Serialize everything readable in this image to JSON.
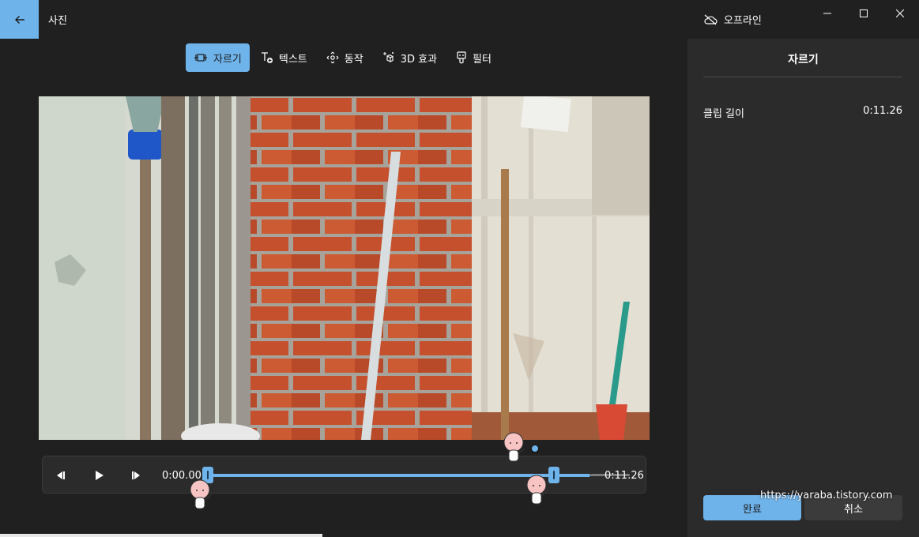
{
  "window": {
    "title": "사진",
    "offline_label": "오프라인",
    "controls": [
      "minimize-icon",
      "maximize-icon",
      "close-icon"
    ]
  },
  "toolbar": {
    "items": [
      {
        "label": "자르기",
        "icon": "trim-icon",
        "active": true
      },
      {
        "label": "텍스트",
        "icon": "text-add-icon",
        "active": false
      },
      {
        "label": "동작",
        "icon": "motion-icon",
        "active": false
      },
      {
        "label": "3D 효과",
        "icon": "3d-effects-icon",
        "active": false
      },
      {
        "label": "필터",
        "icon": "filter-icon",
        "active": false
      }
    ]
  },
  "player": {
    "start_time": "0:00.00",
    "end_time": "0:11.26",
    "trim_end_fraction": 1.0,
    "playhead_fraction": 0.9
  },
  "panel": {
    "title": "자르기",
    "clip_length_label": "클립 길이",
    "clip_length_value": "0:11.26",
    "done_label": "완료",
    "cancel_label": "취소"
  },
  "watermark": "https://yaraba.tistory.com",
  "colors": {
    "accent": "#6fb3eb",
    "background": "#202020",
    "panel": "#2b2b2b"
  }
}
